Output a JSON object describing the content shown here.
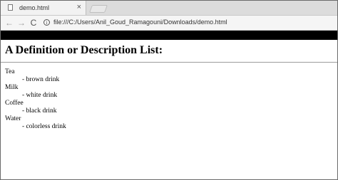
{
  "browser": {
    "tab": {
      "title": "demo.html",
      "close_glyph": "×"
    },
    "toolbar": {
      "back_glyph": "←",
      "forward_glyph": "→",
      "reload_glyph": "C",
      "info_glyph": "i",
      "url": "file:///C:/Users/Anil_Goud_Ramagouni/Downloads/demo.html"
    }
  },
  "page": {
    "heading": "A Definition or Description List:",
    "items": [
      {
        "term": "Tea",
        "description": "- brown drink"
      },
      {
        "term": "Milk",
        "description": "- white drink"
      },
      {
        "term": "Coffee",
        "description": "- black drink"
      },
      {
        "term": "Water",
        "description": "- colorless drink"
      }
    ]
  }
}
